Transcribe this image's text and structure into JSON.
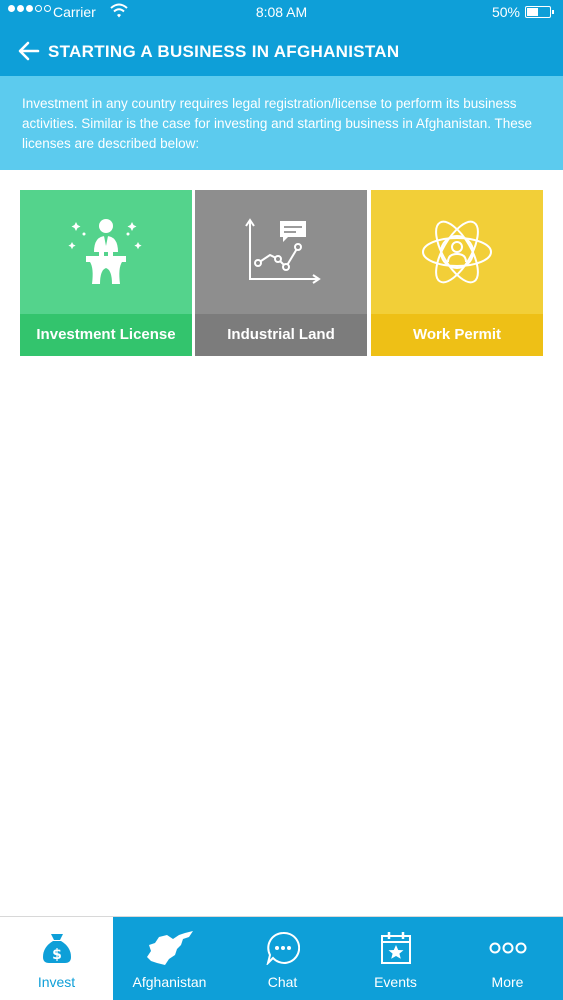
{
  "status_bar": {
    "carrier": "Carrier",
    "time": "8:08 AM",
    "battery_percent": "50%",
    "battery_level": 0.5,
    "signal_bars_filled": 3,
    "signal_bars_total": 5
  },
  "header": {
    "title": "STARTING A BUSINESS IN AFGHANISTAN",
    "back_icon": "arrow-left-icon"
  },
  "intro": {
    "text": "Investment in any country requires legal registration/license to perform its business activities. Similar is the case for investing and starting business in Afghanistan. These licenses are described below:"
  },
  "tiles": [
    {
      "label": "Investment License",
      "icon": "speaker-podium-icon",
      "color": "#54d38c"
    },
    {
      "label": "Industrial Land",
      "icon": "line-chart-icon",
      "color": "#8e8e8e"
    },
    {
      "label": "Work Permit",
      "icon": "person-atom-icon",
      "color": "#f2cf38"
    }
  ],
  "tabbar": {
    "items": [
      {
        "label": "Invest",
        "icon": "money-bag-icon",
        "active": true
      },
      {
        "label": "Afghanistan",
        "icon": "afghanistan-map-icon",
        "active": false
      },
      {
        "label": "Chat",
        "icon": "chat-bubble-icon",
        "active": false
      },
      {
        "label": "Events",
        "icon": "calendar-star-icon",
        "active": false
      },
      {
        "label": "More",
        "icon": "more-dots-icon",
        "active": false
      }
    ]
  },
  "colors": {
    "primary": "#0e9fd8",
    "intro_bg": "#5ccbee"
  }
}
